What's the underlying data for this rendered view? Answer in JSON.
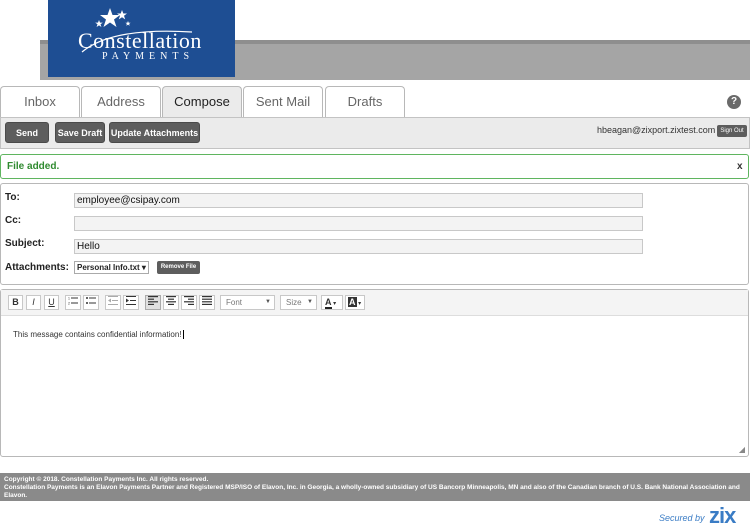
{
  "brand": {
    "name_line1": "Constellation",
    "name_line2": "PAYMENTS",
    "color": "#1e4e93"
  },
  "tabs": [
    {
      "label": "Inbox",
      "active": false
    },
    {
      "label": "Address",
      "active": false
    },
    {
      "label": "Compose",
      "active": true
    },
    {
      "label": "Sent Mail",
      "active": false
    },
    {
      "label": "Drafts",
      "active": false
    }
  ],
  "help_icon": "question-mark-icon",
  "toolbar": {
    "send_label": "Send",
    "save_draft_label": "Save Draft",
    "update_attachments_label": "Update Attachments",
    "user_email": "hbeagan@zixport.zixtest.com",
    "sign_out_label": "Sign Out"
  },
  "notice": {
    "text": "File added.",
    "close_label": "x",
    "color": "#2f8a2f"
  },
  "form": {
    "to_label": "To:",
    "to_value": "employee@csipay.com",
    "cc_label": "Cc:",
    "cc_value": "",
    "subject_label": "Subject:",
    "subject_value": "Hello",
    "attachments_label": "Attachments:",
    "attachment_selected": "Personal Info.txt",
    "remove_file_label": "Remove File"
  },
  "editor": {
    "bold": "B",
    "italic": "I",
    "underline": "U",
    "font_placeholder": "Font",
    "size_placeholder": "Size",
    "font_color": "A",
    "bg_color": "A",
    "body_text": "This message contains confidential information!"
  },
  "footer": {
    "copyright": "Copyright © 2018. Constellation Payments Inc. All rights reserved.",
    "disclaimer": "Constellation Payments is an Elavon Payments Partner and Registered MSP/ISO of Elavon, Inc. in Georgia, a wholly-owned subsidiary of US Bancorp Minneapolis, MN and also of the Canadian branch of U.S. Bank National Association and Elavon."
  },
  "secured_by": {
    "text": "Secured by",
    "brand": "zix",
    "color": "#3a7cc5"
  }
}
